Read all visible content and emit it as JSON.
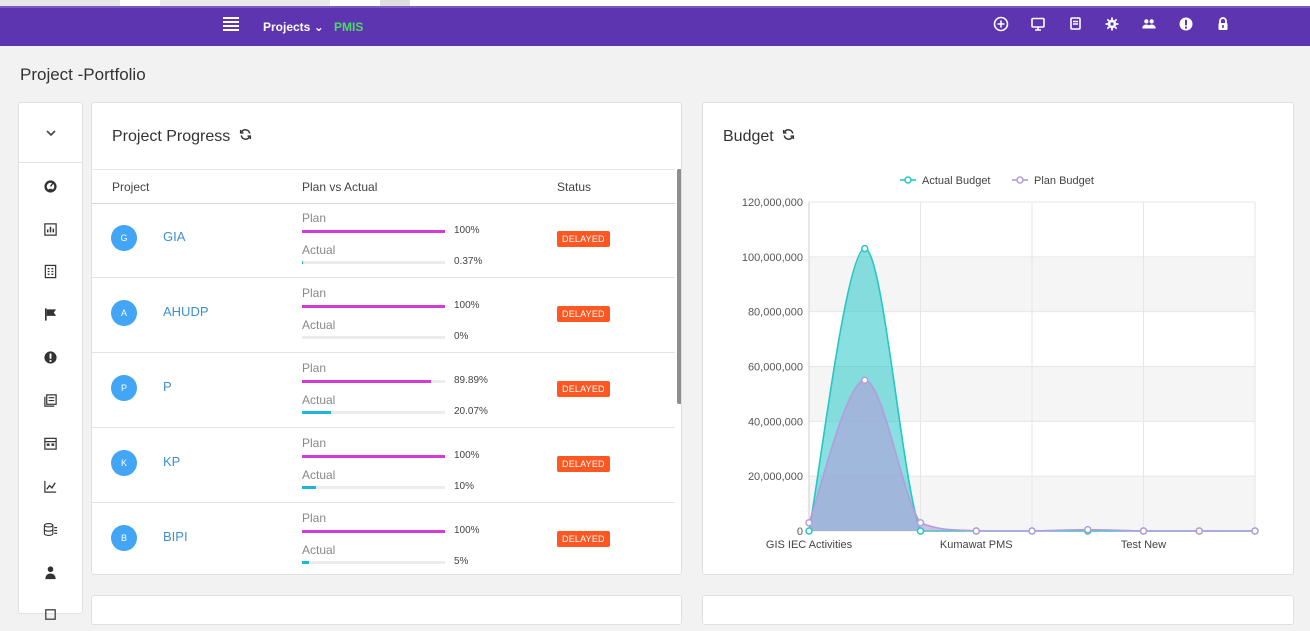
{
  "topbar": {
    "projects_label": "Projects ⌄",
    "brand": "PMIS",
    "icons": [
      "add-circle-icon",
      "monitor-icon",
      "copy-icon",
      "gear-icon",
      "users-icon",
      "alert-icon",
      "lock-icon"
    ]
  },
  "page": {
    "title": "Project -Portfolio"
  },
  "sidebar": {
    "items": [
      "dashboard-icon",
      "chart-frame-icon",
      "report-icon",
      "flag-icon",
      "alert-icon",
      "stack-icon",
      "calendar-icon",
      "line-chart-icon",
      "database-icon",
      "user-icon"
    ]
  },
  "progress": {
    "title": "Project Progress",
    "headers": {
      "project": "Project",
      "plan_vs_actual": "Plan vs Actual",
      "status": "Status"
    },
    "plan_label": "Plan",
    "actual_label": "Actual",
    "rows": [
      {
        "initial": "G",
        "name": "GIA",
        "plan": 1.0,
        "plan_text": "100%",
        "actual": 0.0037,
        "actual_text": "0.37%",
        "status": "DELAYED"
      },
      {
        "initial": "A",
        "name": "AHUDP",
        "plan": 1.0,
        "plan_text": "100%",
        "actual": 0.0,
        "actual_text": "0%",
        "status": "DELAYED"
      },
      {
        "initial": "P",
        "name": "P",
        "plan": 0.8989,
        "plan_text": "89.89%",
        "actual": 0.2007,
        "actual_text": "20.07%",
        "status": "DELAYED"
      },
      {
        "initial": "K",
        "name": "KP",
        "plan": 1.0,
        "plan_text": "100%",
        "actual": 0.1,
        "actual_text": "10%",
        "status": "DELAYED"
      },
      {
        "initial": "B",
        "name": "BIPI",
        "plan": 1.0,
        "plan_text": "100%",
        "actual": 0.05,
        "actual_text": "5%",
        "status": "DELAYED"
      }
    ]
  },
  "budget": {
    "title": "Budget",
    "colors": {
      "actual": "#26c6c6",
      "plan": "#b39ddb"
    }
  },
  "chart_data": {
    "type": "area",
    "x_tick_labels": [
      "GIS IEC Activities",
      "Kumawat PMS",
      "Test New"
    ],
    "ylim": [
      0,
      120000000
    ],
    "yticks": [
      "0",
      "20,000,000",
      "40,000,000",
      "60,000,000",
      "80,000,000",
      "100,000,000",
      "120,000,000"
    ],
    "ytick_values": [
      0,
      20000000,
      40000000,
      60000000,
      80000000,
      100000000,
      120000000
    ],
    "legend": "top-center",
    "grid": true,
    "series": [
      {
        "name": "Actual Budget",
        "values": [
          0,
          103000000,
          0,
          0,
          0,
          0,
          0,
          0,
          0
        ]
      },
      {
        "name": "Plan Budget",
        "values": [
          3000000,
          55000000,
          3000000,
          0,
          0,
          500000,
          0,
          0,
          0
        ]
      }
    ]
  }
}
